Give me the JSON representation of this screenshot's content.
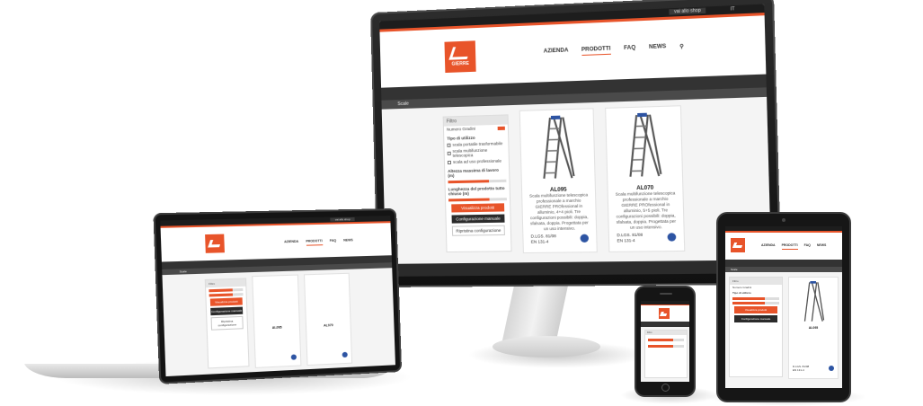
{
  "site": {
    "shop_label": "vai allo shop",
    "lang_label": "IT",
    "logo_text": "GIERRE",
    "nav": [
      "AZIENDA",
      "PRODOTTI",
      "FAQ",
      "NEWS"
    ],
    "breadcrumb": "Scale",
    "filters": {
      "title": "Filtro",
      "search_label": "Numero Gradini",
      "type_title": "Tipo di utilizzo",
      "type_options": [
        "scala portatile trasformabile",
        "scala multifunzione telescopica",
        "scala ad uso professionale"
      ],
      "height_title": "Altezza massima di lavoro (m)",
      "length_title": "Lunghezza del prodotto tutto chiuso (m)",
      "btn_filter": "Visualizza prodotti",
      "btn_config": "Configurazione manuale",
      "btn_reset": "Ripristina configurazione"
    },
    "products": [
      {
        "name": "AL095",
        "description": "Scala multifunzione telescopica professionale a marchio GIERRE PROfessional in alluminio, 4+4 pioli. Tre configurazioni possibili: doppia, sfalsata, doppia. Progettata per un uso intensivo.",
        "code_line1": "D.LGS. 81/08",
        "code_line2": "EN 131-4"
      },
      {
        "name": "AL070",
        "description": "Scala multifunzione telescopica professionale a marchio GIERRE PROfessional in alluminio, 5+5 pioli. Tre configurazioni possibili: doppia, sfalsata, doppia. Progettata per un uso intensivo.",
        "code_line1": "D.LGS. 81/08",
        "code_line2": "EN 131-4"
      }
    ]
  },
  "colors": {
    "accent": "#e8542a",
    "dark": "#2b2b2b",
    "badge": "#2d54a3"
  }
}
